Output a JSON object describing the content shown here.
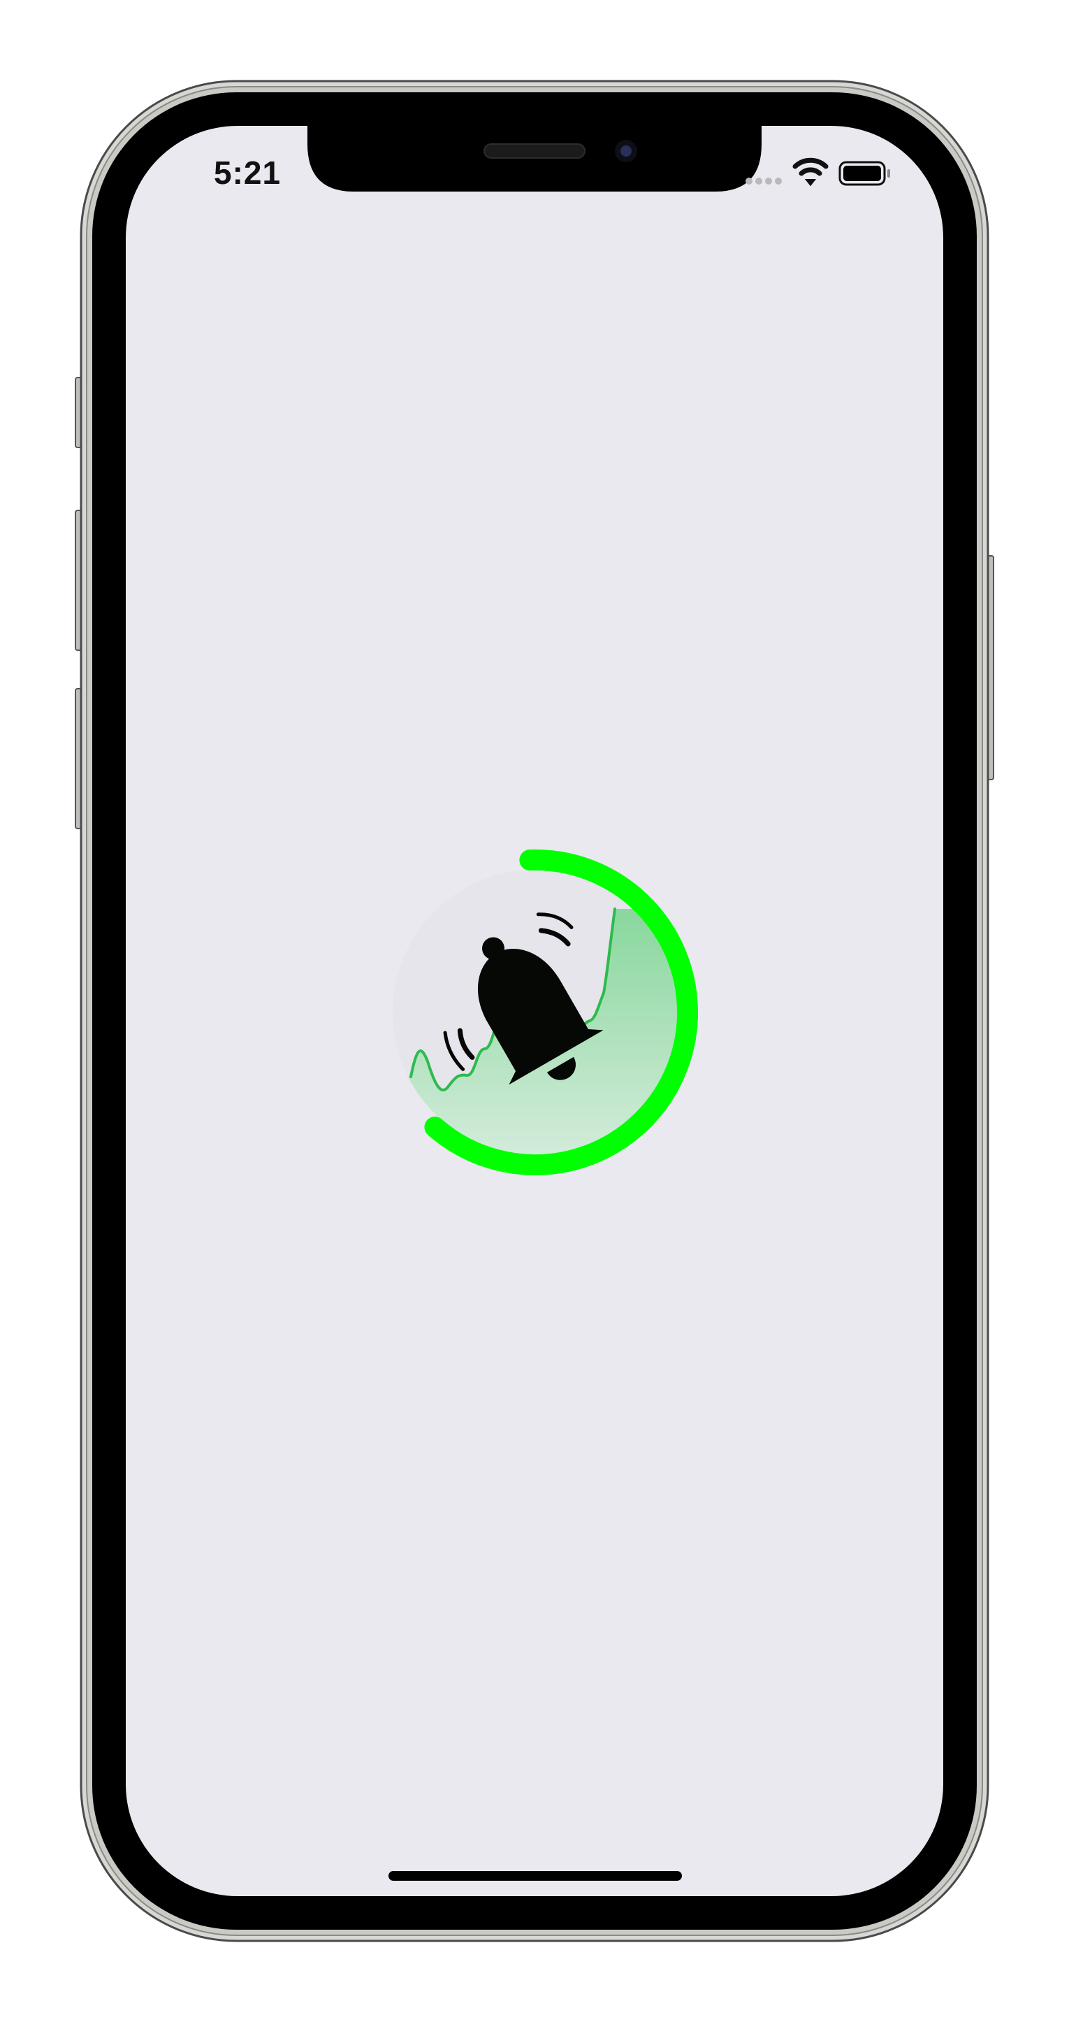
{
  "status_bar": {
    "time": "5:21",
    "wifi_icon": "wifi-icon",
    "battery_icon": "battery-icon",
    "signal_icon": "cellular-signal-icon"
  },
  "main": {
    "icon": "ringing-bell-icon",
    "progress": 0.62,
    "colors": {
      "accent": "#00FF00",
      "wave_line": "#2DBA4E",
      "wave_fill_top": "#7ED694",
      "wave_fill_bottom": "#DCEFE2",
      "screen_background": "#EAE9EF"
    }
  },
  "device": {
    "frame_color": "#000000",
    "home_indicator": "home-indicator"
  }
}
